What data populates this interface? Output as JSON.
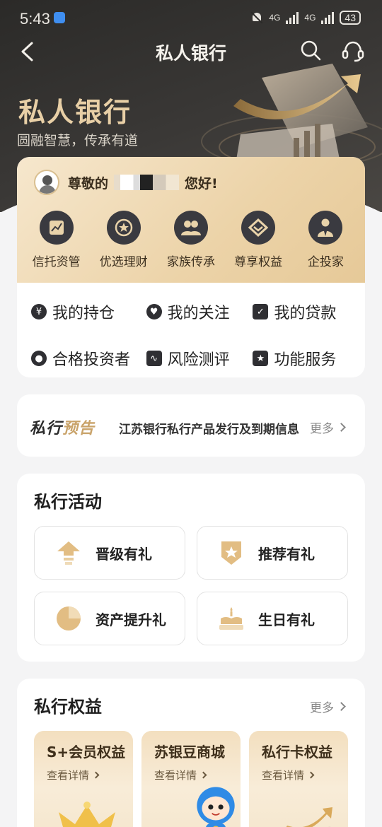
{
  "status_bar": {
    "time": "5:43",
    "network1": "4G",
    "network2": "4G",
    "battery": "43"
  },
  "nav": {
    "title": "私人银行"
  },
  "hero": {
    "title": "私人银行",
    "subtitle": "圆融智慧，传承有道"
  },
  "greeting": {
    "prefix": "尊敬的",
    "suffix": "您好!"
  },
  "quick_actions": [
    {
      "label": "信托资管",
      "icon": "trust-chart-icon"
    },
    {
      "label": "优选理财",
      "icon": "star-badge-icon"
    },
    {
      "label": "家族传承",
      "icon": "family-icon"
    },
    {
      "label": "尊享权益",
      "icon": "diamond-icon"
    },
    {
      "label": "企投家",
      "icon": "businessman-icon"
    }
  ],
  "links": [
    {
      "label": "我的持仓",
      "icon": "yen-icon",
      "glyph": "¥"
    },
    {
      "label": "我的关注",
      "icon": "heart-icon",
      "glyph": "♥"
    },
    {
      "label": "我的贷款",
      "icon": "calendar-check-icon",
      "glyph": "✓"
    },
    {
      "label": "合格投资者",
      "icon": "person-icon",
      "glyph": "●"
    },
    {
      "label": "风险测评",
      "icon": "pulse-icon",
      "glyph": "∿"
    },
    {
      "label": "功能服务",
      "icon": "service-star-icon",
      "glyph": "★"
    }
  ],
  "preview": {
    "logo_a": "私行",
    "logo_b": "预告",
    "text": "江苏银行私行产品发行及到期信息",
    "more": "更多"
  },
  "activities": {
    "title": "私行活动",
    "items": [
      {
        "label": "晋级有礼",
        "icon": "upgrade-arrow-icon"
      },
      {
        "label": "推荐有礼",
        "icon": "star-shield-icon"
      },
      {
        "label": "资产提升礼",
        "icon": "pie-chart-icon"
      },
      {
        "label": "生日有礼",
        "icon": "birthday-cake-icon"
      }
    ]
  },
  "benefits": {
    "title": "私行权益",
    "more": "更多",
    "items": [
      {
        "title": "S+会员权益",
        "link": "查看详情",
        "art": "crown-icon"
      },
      {
        "title": "苏银豆商城",
        "link": "查看详情",
        "art": "mascot-icon"
      },
      {
        "title": "私行卡权益",
        "link": "查看详情",
        "art": "card-chart-icon"
      }
    ]
  },
  "colors": {
    "hero_bg": "#2b2a28",
    "gold": "#e8cfa6",
    "card_gold": "#ecd3a8",
    "icon_dark": "#3a3a40"
  }
}
